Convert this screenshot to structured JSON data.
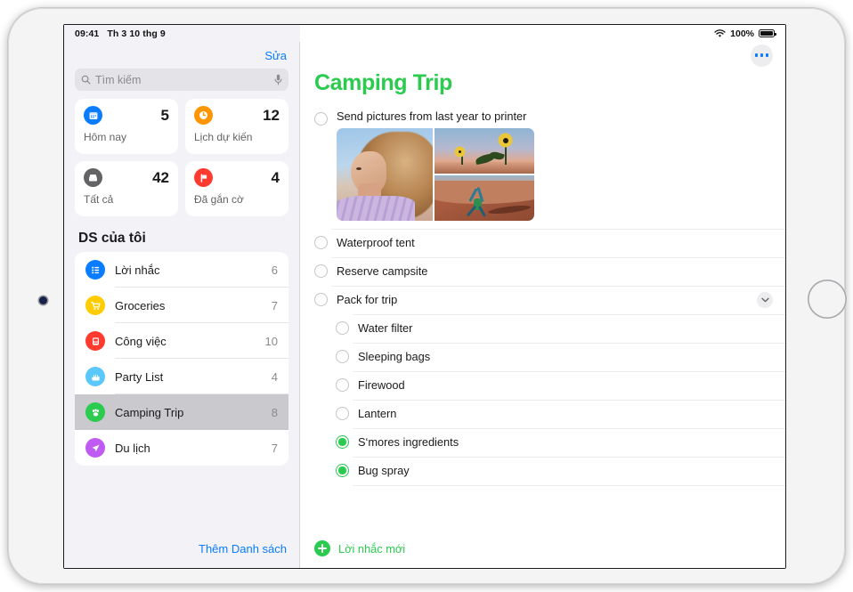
{
  "colors": {
    "green": "#2ACB4F",
    "blue": "#0a7cff",
    "today": "#0a7cff",
    "scheduled": "#FF9500",
    "all": "#636366",
    "flagged": "#FF3B30"
  },
  "status_bar": {
    "time": "09:41",
    "date": "Th 3 10 thg 9",
    "wifi_icon": "wifi-icon",
    "battery_percent": "100%",
    "battery_icon": "battery-icon"
  },
  "sidebar": {
    "edit_label": "Sửa",
    "search": {
      "placeholder": "Tìm kiếm",
      "search_icon": "search-icon",
      "mic_icon": "microphone-icon"
    },
    "smart_lists": [
      {
        "label": "Hôm nay",
        "count": "5",
        "icon": "calendar-icon",
        "color": "#0a7cff"
      },
      {
        "label": "Lịch dự kiến",
        "count": "12",
        "icon": "clock-icon",
        "color": "#FF9500"
      },
      {
        "label": "Tất cả",
        "count": "42",
        "icon": "inbox-icon",
        "color": "#636366"
      },
      {
        "label": "Đã gắn cờ",
        "count": "4",
        "icon": "flag-icon",
        "color": "#FF3B30"
      }
    ],
    "my_lists_title": "DS của tôi",
    "lists": [
      {
        "label": "Lời nhắc",
        "count": "6",
        "icon": "bullet-list-icon",
        "color": "#0a7cff",
        "selected": false
      },
      {
        "label": "Groceries",
        "count": "7",
        "icon": "shopping-cart-icon",
        "color": "#FFCC00",
        "selected": false
      },
      {
        "label": "Công việc",
        "count": "10",
        "icon": "briefcase-icon",
        "color": "#FF3B30",
        "selected": false
      },
      {
        "label": "Party List",
        "count": "4",
        "icon": "cake-icon",
        "color": "#5AC8FA",
        "selected": false
      },
      {
        "label": "Camping Trip",
        "count": "8",
        "icon": "paw-icon",
        "color": "#2ACB4F",
        "selected": true
      },
      {
        "label": "Du lịch",
        "count": "7",
        "icon": "paper-plane-icon",
        "color": "#BF5AF2",
        "selected": false
      }
    ],
    "add_list_label": "Thêm Danh sách"
  },
  "main": {
    "more_button_icon": "more-ellipsis-icon",
    "title": "Camping Trip",
    "tasks": [
      {
        "text": "Send pictures from last year to printer",
        "done": false,
        "sub": false,
        "photos": true
      },
      {
        "text": "Waterproof tent",
        "done": false,
        "sub": false
      },
      {
        "text": "Reserve campsite",
        "done": false,
        "sub": false
      },
      {
        "text": "Pack for trip",
        "done": false,
        "sub": false,
        "chevron": "chevron-down-icon"
      },
      {
        "text": "Water filter",
        "done": false,
        "sub": true
      },
      {
        "text": "Sleeping bags",
        "done": false,
        "sub": true
      },
      {
        "text": "Firewood",
        "done": false,
        "sub": true
      },
      {
        "text": "Lantern",
        "done": false,
        "sub": true
      },
      {
        "text": "S‘mores ingredients",
        "done": true,
        "sub": true
      },
      {
        "text": "Bug spray",
        "done": true,
        "sub": true
      }
    ],
    "new_reminder_label": "Lời nhắc mới",
    "add_icon": "plus-circle-icon"
  }
}
